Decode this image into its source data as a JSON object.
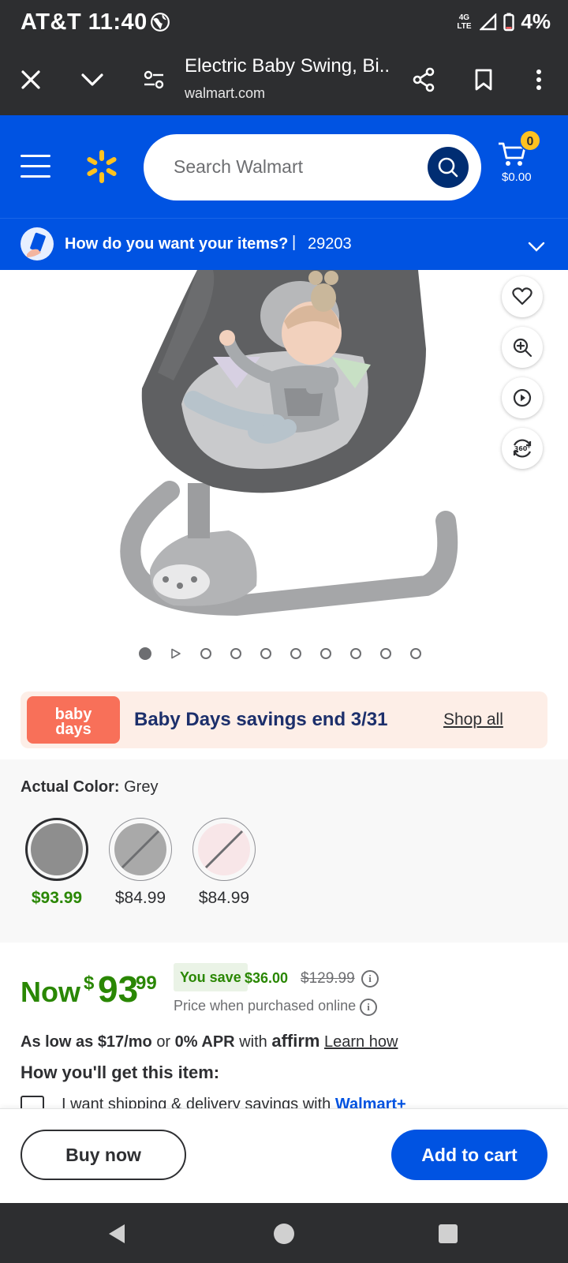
{
  "status_bar": {
    "carrier_time": "AT&T 11:40",
    "network": "4G LTE",
    "battery": "4%"
  },
  "browser": {
    "title": "Electric Baby Swing, Bi...",
    "url": "walmart.com"
  },
  "header": {
    "search_placeholder": "Search Walmart",
    "cart_count": "0",
    "cart_total": "$0.00",
    "delivery_prompt": "How do you want your items?",
    "separator": "|",
    "zip": "29203"
  },
  "gallery": {
    "image_count": 10,
    "active_index": 0
  },
  "promo": {
    "logo_line1": "baby",
    "logo_line2": "days",
    "text": "Baby Days savings end 3/31",
    "link": "Shop all"
  },
  "color": {
    "label": "Actual Color:",
    "value": "Grey",
    "swatches": [
      {
        "color": "#8e8e8e",
        "price": "$93.99",
        "selected": true,
        "available": true
      },
      {
        "color": "#a9a9a9",
        "price": "$84.99",
        "selected": false,
        "available": false
      },
      {
        "color": "#f8e6e8",
        "price": "$84.99",
        "selected": false,
        "available": false
      }
    ]
  },
  "price": {
    "now_label": "Now",
    "currency": "$",
    "dollars": "93",
    "cents": "99",
    "you_save_label": "You save",
    "save_amount": "$36.00",
    "was_price": "$129.99",
    "note": "Price when purchased online"
  },
  "financing": {
    "as_low_as": "As low as $17/mo",
    "or": "or",
    "apr": "0% APR",
    "with": "with",
    "affirm": "affirm",
    "learn_how": "Learn how"
  },
  "fulfillment": {
    "heading": "How you'll get this item:",
    "shipping_text": "I want shipping & delivery savings with",
    "walmart_plus": "Walmart+"
  },
  "actions": {
    "buy_now": "Buy now",
    "add_to_cart": "Add to cart"
  },
  "colors": {
    "brand_blue": "#0053e2",
    "dark_navy": "#002d72",
    "spark_yellow": "#ffc220",
    "price_green": "#2a8703"
  }
}
